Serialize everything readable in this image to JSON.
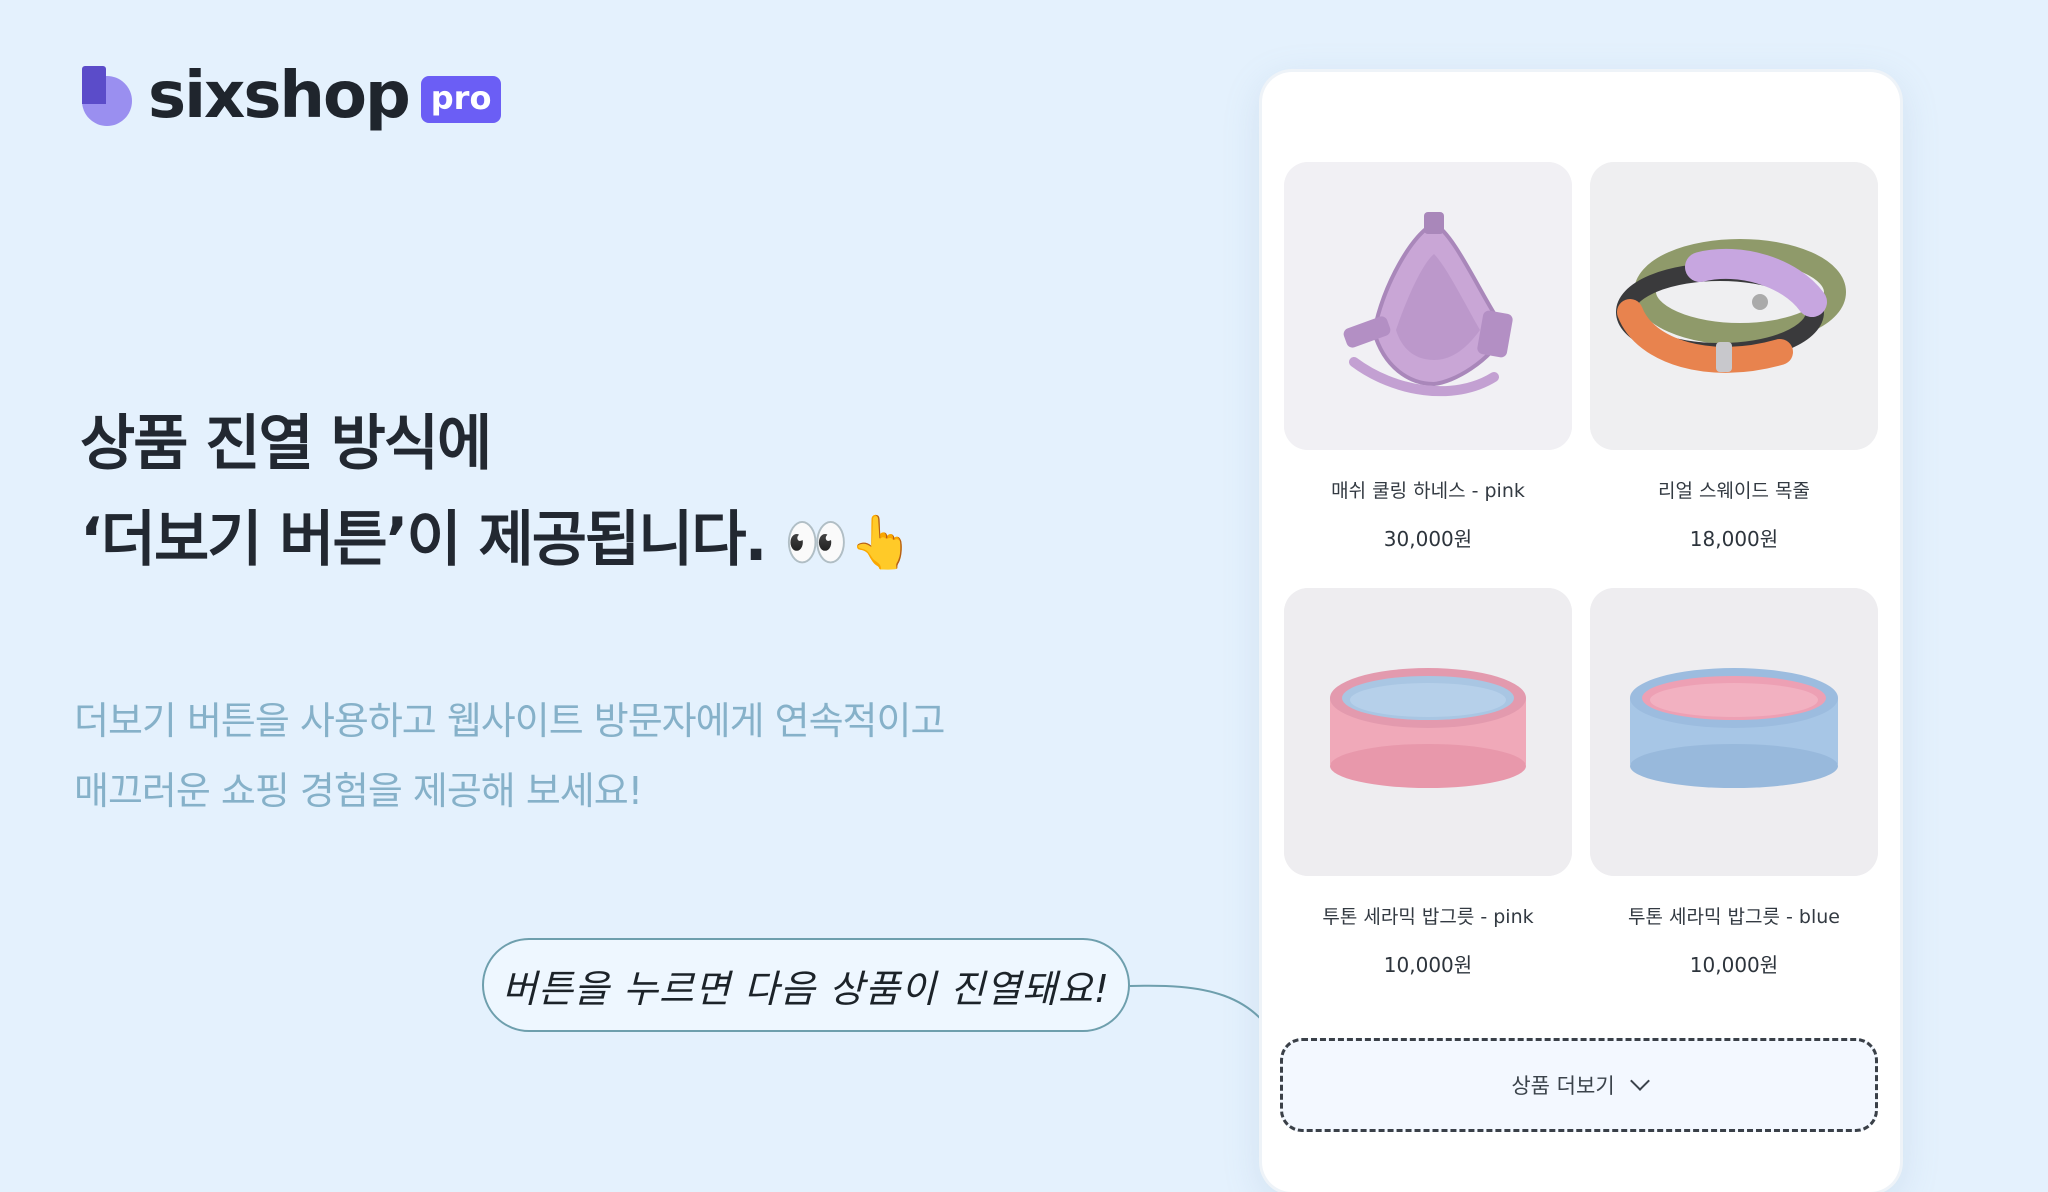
{
  "brand": {
    "name": "sixshop",
    "badge": "pro"
  },
  "headline": {
    "line1": "상품 진열 방식에",
    "line2": "‘더보기 버튼’이 제공됩니다.",
    "emoji": "👀👆"
  },
  "description": {
    "line1": "더보기 버튼을 사용하고 웹사이트 방문자에게 연속적이고",
    "line2": "매끄러운 쇼핑 경험을 제공해 보세요!"
  },
  "callout": {
    "text": "버튼을 누르면 다음 상품이 진열돼요!"
  },
  "products": [
    {
      "name": "매쉬 쿨링 하네스 - pink",
      "price": "30,000원"
    },
    {
      "name": "리얼 스웨이드 목줄",
      "price": "18,000원"
    },
    {
      "name": "투톤 세라믹 밥그릇 - pink",
      "price": "10,000원"
    },
    {
      "name": "투톤 세라믹 밥그릇 - blue",
      "price": "10,000원"
    }
  ],
  "load_more": {
    "label": "상품 더보기",
    "icon": "chevron-down-icon"
  },
  "colors": {
    "background": "#e4f1fd",
    "brand_purple": "#6b5ef5",
    "description_text": "#86b1c9",
    "callout_border": "#6e9fad"
  }
}
